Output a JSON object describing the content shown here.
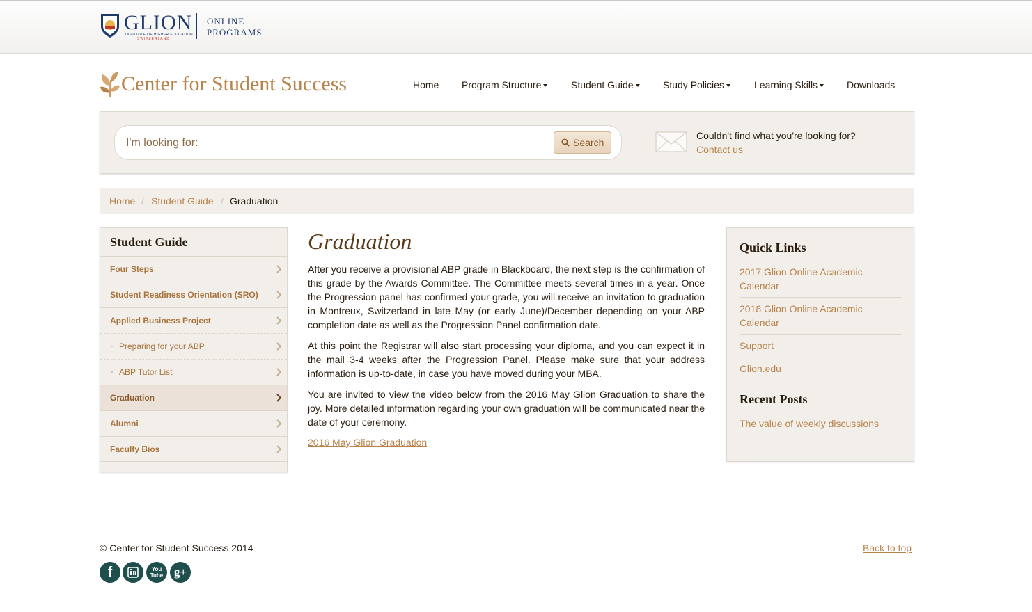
{
  "header": {
    "logo_word": "GLION",
    "logo_sub": "INSTITUTE OF HIGHER EDUCATION",
    "logo_sub2": "SWITZERLAND",
    "logo_online_1": "ONLINE",
    "logo_online_2": "PROGRAMS"
  },
  "brand": {
    "title": "Center for Student Success"
  },
  "nav": {
    "items": [
      {
        "label": "Home"
      },
      {
        "label": "Program Structure"
      },
      {
        "label": "Student Guide"
      },
      {
        "label": "Study Policies"
      },
      {
        "label": "Learning Skills"
      },
      {
        "label": "Downloads"
      }
    ]
  },
  "search": {
    "placeholder": "I'm looking for:",
    "button_label": "Search",
    "help_text": "Couldn't find what you're looking for?",
    "contact_label": "Contact us"
  },
  "breadcrumb": {
    "home": "Home",
    "section": "Student Guide",
    "current": "Graduation",
    "sep": "/"
  },
  "sidebar": {
    "title": "Student Guide",
    "items": [
      {
        "label": "Four Steps"
      },
      {
        "label": "Student Readiness Orientation (SRO)"
      },
      {
        "label": "Applied Business Project"
      },
      {
        "label": "Preparing for your ABP"
      },
      {
        "label": "ABP Tutor List"
      },
      {
        "label": "Graduation"
      },
      {
        "label": "Alumni"
      },
      {
        "label": "Faculty Bios"
      }
    ]
  },
  "main": {
    "title": "Graduation",
    "paragraphs": [
      "After you receive a provisional ABP grade in Blackboard, the next step is the confirmation of this grade by the Awards Committee. The Committee meets several times in a year.  Once the Progression panel has confirmed your grade, you will receive an invitation to graduation in Montreux, Switzerland in late May (or early June)/December depending on your ABP completion date as well as the Progression Panel confirmation date.",
      "At this point the Registrar will also start processing your diploma, and you can expect it in the mail 3-4 weeks after the Progression Panel. Please make sure that your address information is up-to-date, in case you have moved during your MBA.",
      "You are invited to view the video below from the 2016 May Glion Graduation to share the joy. More detailed information regarding your own graduation will be communicated near the date of your ceremony."
    ],
    "video_link": "2016 May Glion Graduation"
  },
  "quick_links": {
    "title": "Quick Links",
    "items": [
      {
        "label": "2017 Glion Online Academic Calendar"
      },
      {
        "label": "2018 Glion Online Academic Calendar"
      },
      {
        "label": "Support"
      },
      {
        "label": "Glion.edu"
      }
    ]
  },
  "recent_posts": {
    "title": "Recent Posts",
    "items": [
      {
        "label": "The value of weekly discussions"
      }
    ]
  },
  "footer": {
    "copyright": "© Center for Student Success 2014",
    "back_to_top": "Back to top",
    "social": [
      {
        "icon": "facebook-icon",
        "glyph": "f"
      },
      {
        "icon": "linkedin-icon",
        "glyph": "in"
      },
      {
        "icon": "youtube-icon",
        "glyph": "You\nTube"
      },
      {
        "icon": "google-plus-icon",
        "glyph": "g+"
      }
    ]
  },
  "colors": {
    "accent": "#b8834a",
    "panel": "#f2efea",
    "text": "#2a1d10",
    "social": "#1e4f4c"
  }
}
